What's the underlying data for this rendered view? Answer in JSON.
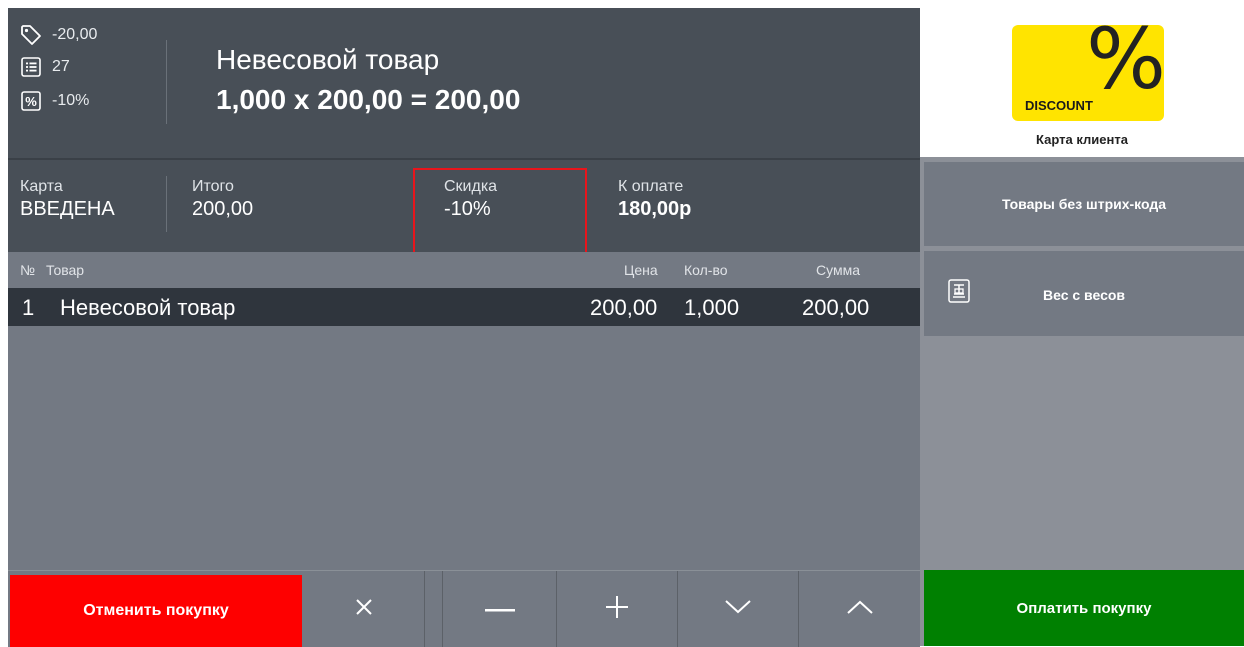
{
  "header": {
    "stats": [
      {
        "icon": "price-tag-icon",
        "value": "-20,00"
      },
      {
        "icon": "list-icon",
        "value": "27"
      },
      {
        "icon": "percent-icon",
        "value": "-10%"
      }
    ],
    "title": "Невесовой товар",
    "calculation": "1,000 x 200,00 = 200,00"
  },
  "summary": {
    "card_label": "Карта",
    "card_value": "ВВЕДЕНА",
    "total_label": "Итого",
    "total_value": "200,00",
    "discount_label": "Скидка",
    "discount_value": "-10%",
    "to_pay_label": "К оплате",
    "to_pay_value": "180,00р",
    "highlight_color": "#e8151c"
  },
  "table": {
    "headers": {
      "num": "№",
      "item": "Товар",
      "price": "Цена",
      "qty": "Кол-во",
      "sum": "Сумма"
    },
    "rows": [
      {
        "num": "1",
        "item": "Невесовой товар",
        "price": "200,00",
        "qty": "1,000",
        "sum": "200,00"
      }
    ]
  },
  "controls": {
    "cancel_label": "Отменить покупку",
    "icons": [
      "close-icon",
      "minus-icon",
      "plus-icon",
      "chevron-down-icon",
      "chevron-up-icon"
    ]
  },
  "sidebar": {
    "card_badge_text": "DISCOUNT",
    "card_badge_symbol": "%",
    "card_label": "Карта клиента",
    "no_barcode_label": "Товары без штрих-кода",
    "scale_label": "Вес с весов",
    "pay_label": "Оплатить покупку"
  },
  "colors": {
    "cancel": "#fe0000",
    "pay": "#008001",
    "header_bg": "#484f57",
    "selected_row": "#2f353d",
    "card_yellow": "#ffe400"
  }
}
